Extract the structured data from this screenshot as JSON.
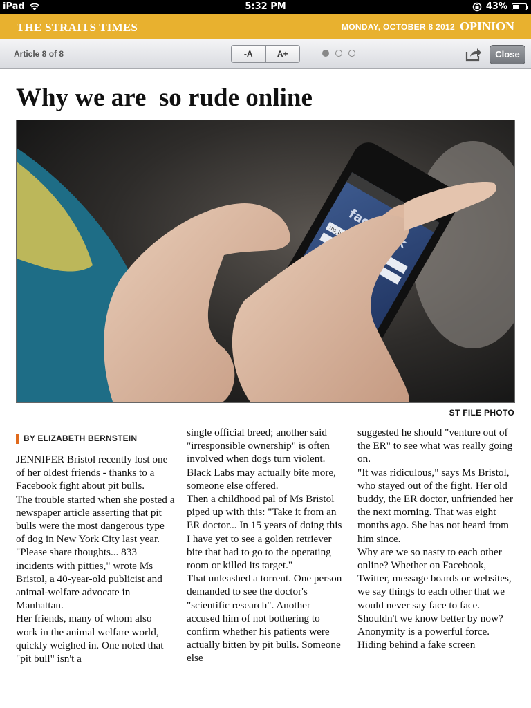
{
  "status_bar": {
    "device": "iPad",
    "time": "5:32 PM",
    "battery_text": "43%",
    "battery_level": 0.43
  },
  "masthead": {
    "brand": "THE STRAITS TIMES",
    "date": "MONDAY, OCTOBER 8 2012",
    "section": "OPINION",
    "color": "#e8b12f"
  },
  "toolbar": {
    "article_count": "Article 8 of 8",
    "font_smaller": "-A",
    "font_larger": "A+",
    "close_label": "Close",
    "page_dots": [
      true,
      false,
      false
    ]
  },
  "article": {
    "headline": "Why we are  so rude online",
    "photo_credit": "ST FILE PHOTO",
    "photo": {
      "screen_brand": "facebook",
      "screen_field": "ms_bristol@yahoo.com"
    },
    "byline": "BY ELIZABETH BERNSTEIN",
    "column1": [
      "JENNIFER Bristol recently lost one of her oldest friends - thanks to a Facebook fight about pit bulls.",
      " The trouble started when she posted a newspaper article asserting that pit bulls were the most dangerous type of dog in New York City last year. \"Please share thoughts... 833 incidents with pitties,\" wrote Ms Bristol, a 40-year-old publicist and animal-welfare advocate in Manhattan.",
      " Her friends, many of whom also work in the animal welfare world, quickly weighed in. One noted that \"pit bull\" isn't a"
    ],
    "column2": [
      "single official breed; another said \"irresponsible ownership\" is often involved when dogs turn violent. Black Labs may actually bite more, someone else offered.",
      " Then a childhood pal of Ms Bristol piped up with this: \"Take it from an ER doctor... In 15 years of doing this I have yet to see a golden retriever bite that had to go to the operating room or killed its target.\"",
      " That unleashed a torrent. One person demanded to see the doctor's \"scientific research\". Another accused him of not bothering to confirm whether his patients were actually bitten by pit bulls. Someone else"
    ],
    "column3": [
      "suggested he should \"venture out of the ER\" to see what was really going on.",
      "\"It was ridiculous,\" says Ms Bristol, who stayed out of the fight. Her old buddy, the ER doctor, unfriended her the next morning. That was eight months ago. She has not heard from him since.",
      " Why are we so nasty to each other online? Whether on Facebook, Twitter, message boards or websites, we say things to each other that we would never say face to face. Shouldn't we know better by now?",
      " Anonymity is a powerful force. Hiding behind a fake screen"
    ]
  }
}
